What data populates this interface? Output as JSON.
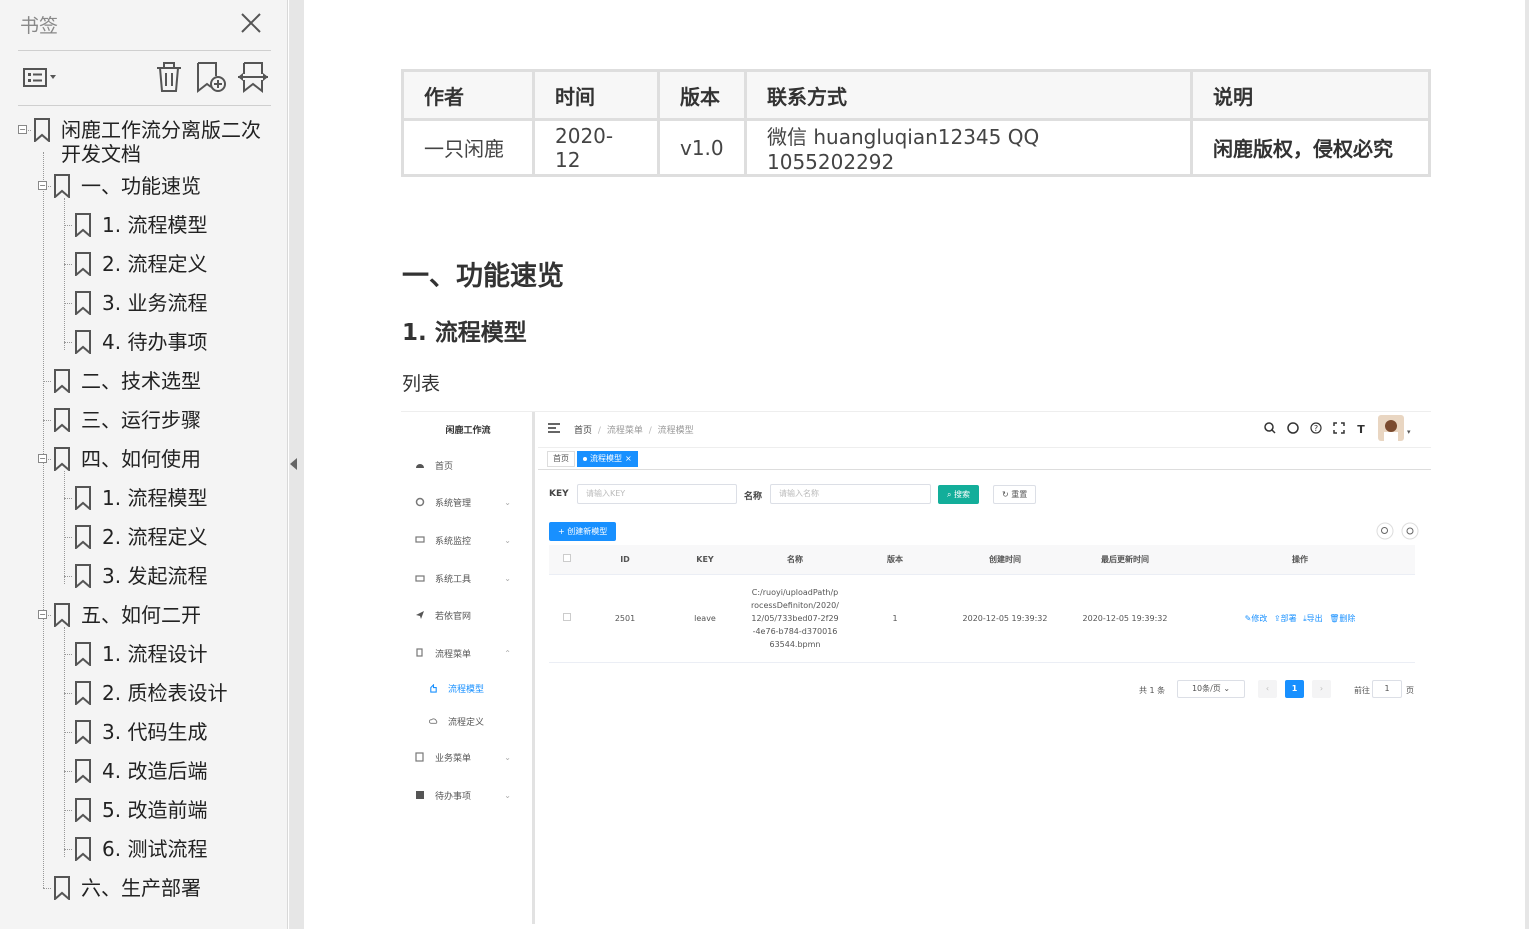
{
  "sidebar": {
    "title": "书签",
    "items": [
      {
        "label": "闲鹿工作流分离版二次开发文档"
      },
      {
        "label": "一、功能速览"
      },
      {
        "label": "1. 流程模型"
      },
      {
        "label": "2. 流程定义"
      },
      {
        "label": "3. 业务流程"
      },
      {
        "label": "4. 待办事项"
      },
      {
        "label": "二、技术选型"
      },
      {
        "label": "三、运行步骤"
      },
      {
        "label": "四、如何使用"
      },
      {
        "label": "1. 流程模型"
      },
      {
        "label": "2. 流程定义"
      },
      {
        "label": "3. 发起流程"
      },
      {
        "label": "五、如何二开"
      },
      {
        "label": "1. 流程设计"
      },
      {
        "label": "2. 质检表设计"
      },
      {
        "label": "3. 代码生成"
      },
      {
        "label": "4. 改造后端"
      },
      {
        "label": "5. 改造前端"
      },
      {
        "label": "6. 测试流程"
      },
      {
        "label": "六、生产部署"
      }
    ]
  },
  "doc": {
    "table": {
      "headers": [
        "作者",
        "时间",
        "版本",
        "联系方式",
        "说明"
      ],
      "row": [
        "一只闲鹿",
        "2020-12",
        "v1.0",
        "微信 huangluqian12345 QQ 1055202292",
        "闲鹿版权，侵权必究"
      ]
    },
    "h1": "一、功能速览",
    "h2": "1. 流程模型",
    "para": "列表"
  },
  "shot": {
    "brand": "闲鹿工作流",
    "menu": [
      "首页",
      "系统管理",
      "系统监控",
      "系统工具",
      "若依官网",
      "流程菜单",
      "流程模型",
      "流程定义",
      "业务菜单",
      "待办事项"
    ],
    "breadcrumb": [
      "首页",
      "流程菜单",
      "流程模型"
    ],
    "tags": [
      "首页",
      "流程模型"
    ],
    "key_label": "KEY",
    "key_placeholder": "请输入KEY",
    "name_label": "名称",
    "name_placeholder": "请输入名称",
    "search_btn": "搜索",
    "reset_btn": "重置",
    "create_btn": "创建新模型",
    "columns": [
      "ID",
      "KEY",
      "名称",
      "版本",
      "创建时间",
      "最后更新时间",
      "操作"
    ],
    "row": {
      "id": "2501",
      "key": "leave",
      "name": "C:/ruoyi/uploadPath/processDefiniton/2020/12/05/733bed07-2f29-4e76-b784-d37001663544.bpmn",
      "version": "1",
      "created": "2020-12-05 19:39:32",
      "updated": "2020-12-05 19:39:32",
      "ops": [
        "修改",
        "部署",
        "导出",
        "删除"
      ]
    },
    "pagination": {
      "total": "共 1 条",
      "size": "10条/页",
      "page": "1",
      "goto": "前往",
      "goto_value": "1",
      "page_unit": "页"
    }
  }
}
